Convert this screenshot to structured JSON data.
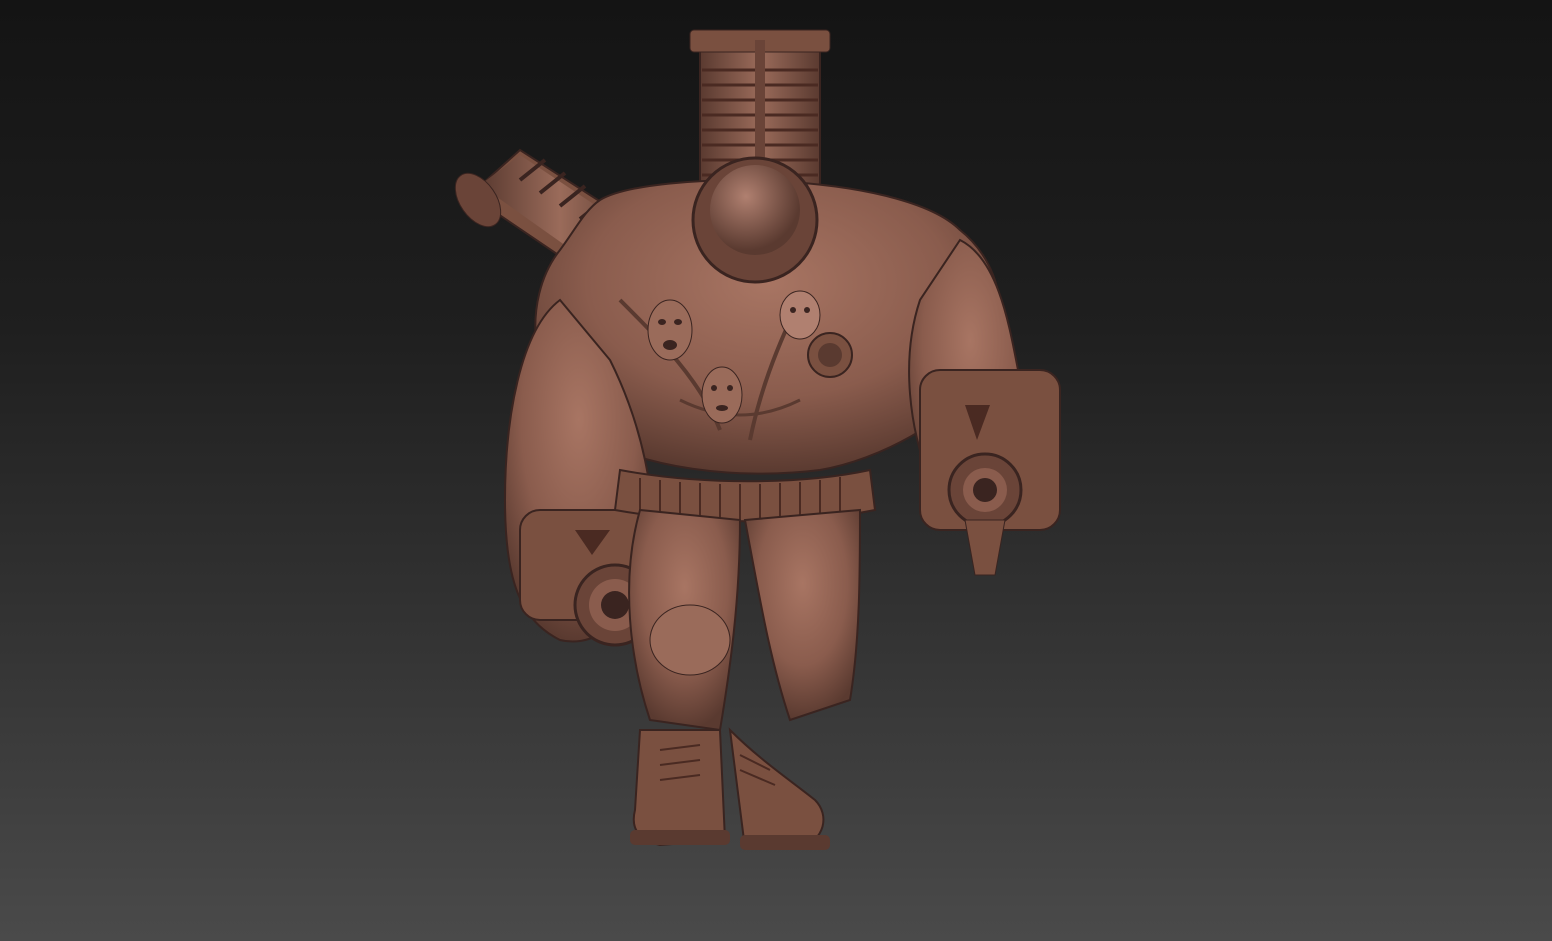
{
  "viewport": {
    "background_top": "#141414",
    "background_bottom": "#4a4a4a"
  },
  "model": {
    "material_color": "#8a5c4d",
    "highlight_color": "#a87563",
    "shadow_color": "#4a2a22"
  }
}
